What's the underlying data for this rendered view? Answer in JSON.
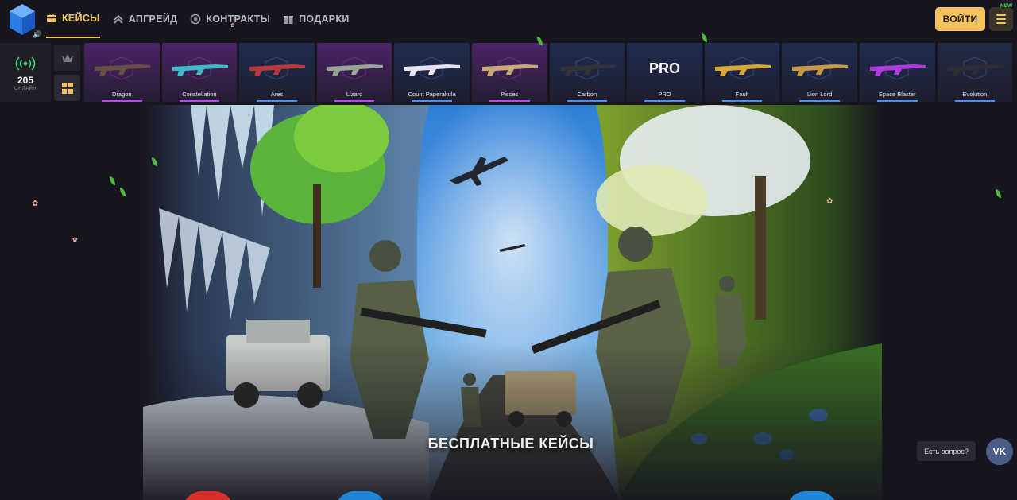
{
  "header": {
    "nav": [
      {
        "label": "КЕЙСЫ",
        "icon": "case-icon",
        "active": true
      },
      {
        "label": "АПГРЕЙД",
        "icon": "upgrade-icon",
        "active": false
      },
      {
        "label": "КОНТРАКТЫ",
        "icon": "contract-icon",
        "active": false
      },
      {
        "label": "ПОДАРКИ",
        "icon": "gift-icon",
        "active": false
      }
    ],
    "login_label": "ВОЙТИ",
    "new_badge": "NEW"
  },
  "online": {
    "count": "205",
    "label": "ОНЛАЙН"
  },
  "live_drops": [
    {
      "name": "Dragon",
      "tint": "#4b2466",
      "bar": "#b14df0",
      "gun": "#6a4d45"
    },
    {
      "name": "Constellation",
      "tint": "#4b2466",
      "bar": "#b14df0",
      "gun": "#3fb8c8"
    },
    {
      "name": "Ares",
      "tint": "#1f2c4f",
      "bar": "#4d8cf0",
      "gun": "#b83a3a"
    },
    {
      "name": "Lizard",
      "tint": "#4b2466",
      "bar": "#b14df0",
      "gun": "#9aa59a"
    },
    {
      "name": "Count Paperakula",
      "tint": "#1f2c4f",
      "bar": "#4d8cf0",
      "gun": "#e8e1f0"
    },
    {
      "name": "Pisces",
      "tint": "#4b2466",
      "bar": "#b14df0",
      "gun": "#c9a87a"
    },
    {
      "name": "Carbon",
      "tint": "#1f2c4f",
      "bar": "#4d8cf0",
      "gun": "#333339"
    },
    {
      "name": "PRO",
      "tint": "#1f2c4f",
      "bar": "#4d8cf0",
      "gun": "#ffffff"
    },
    {
      "name": "Fault",
      "tint": "#1f2c4f",
      "bar": "#4d8cf0",
      "gun": "#d8a836"
    },
    {
      "name": "Lion Lord",
      "tint": "#1f2c4f",
      "bar": "#4d8cf0",
      "gun": "#c79a4a"
    },
    {
      "name": "Space Blaster",
      "tint": "#1f2c4f",
      "bar": "#4d8cf0",
      "gun": "#b03ae0"
    },
    {
      "name": "Evolution",
      "tint": "#222a44",
      "bar": "#4d8cf0",
      "gun": "#2c2c33"
    }
  ],
  "hero": {
    "title": "БЕСПЛАТНЫЕ КЕЙСЫ"
  },
  "support": {
    "help_label": "Есть вопрос?",
    "vk_label": "VK"
  },
  "colors": {
    "accent": "#f5c35e",
    "background": "#17161f",
    "card_blue": "#1f2c4f",
    "card_purple": "#4b2466"
  }
}
